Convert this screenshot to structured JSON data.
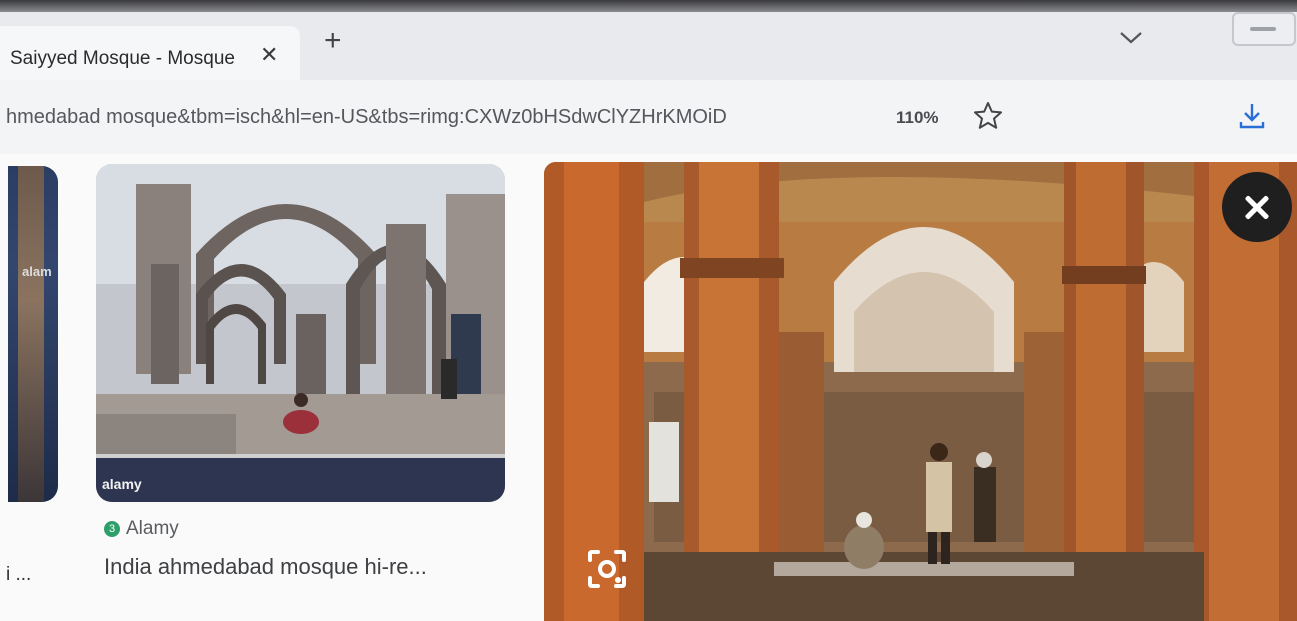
{
  "tab": {
    "title": "Saiyyed Mosque - Mosque",
    "close_glyph": "✕",
    "new_tab_glyph": "+"
  },
  "address": {
    "url": "hmedabad mosque&tbm=isch&hl=en-US&tbs=rimg:CXWz0bHSdwClYZHrKMOiD",
    "zoom": "110%"
  },
  "left_card": {
    "caption": "i ...",
    "watermark": "alam"
  },
  "result": {
    "source_badge": "3",
    "source": "Alamy",
    "title": "India ahmedabad mosque hi-re...",
    "watermark": "alamy"
  },
  "icons": {
    "tab_close": "close-icon",
    "new_tab": "plus-icon",
    "tab_dropdown": "chevron-down-icon",
    "favorite": "star-icon",
    "download": "download-icon",
    "preview_close": "close-icon",
    "lens": "lens-icon"
  },
  "colors": {
    "accent": "#2f9f6a",
    "text": "#3e4044",
    "close_bg": "#1f1f20"
  }
}
